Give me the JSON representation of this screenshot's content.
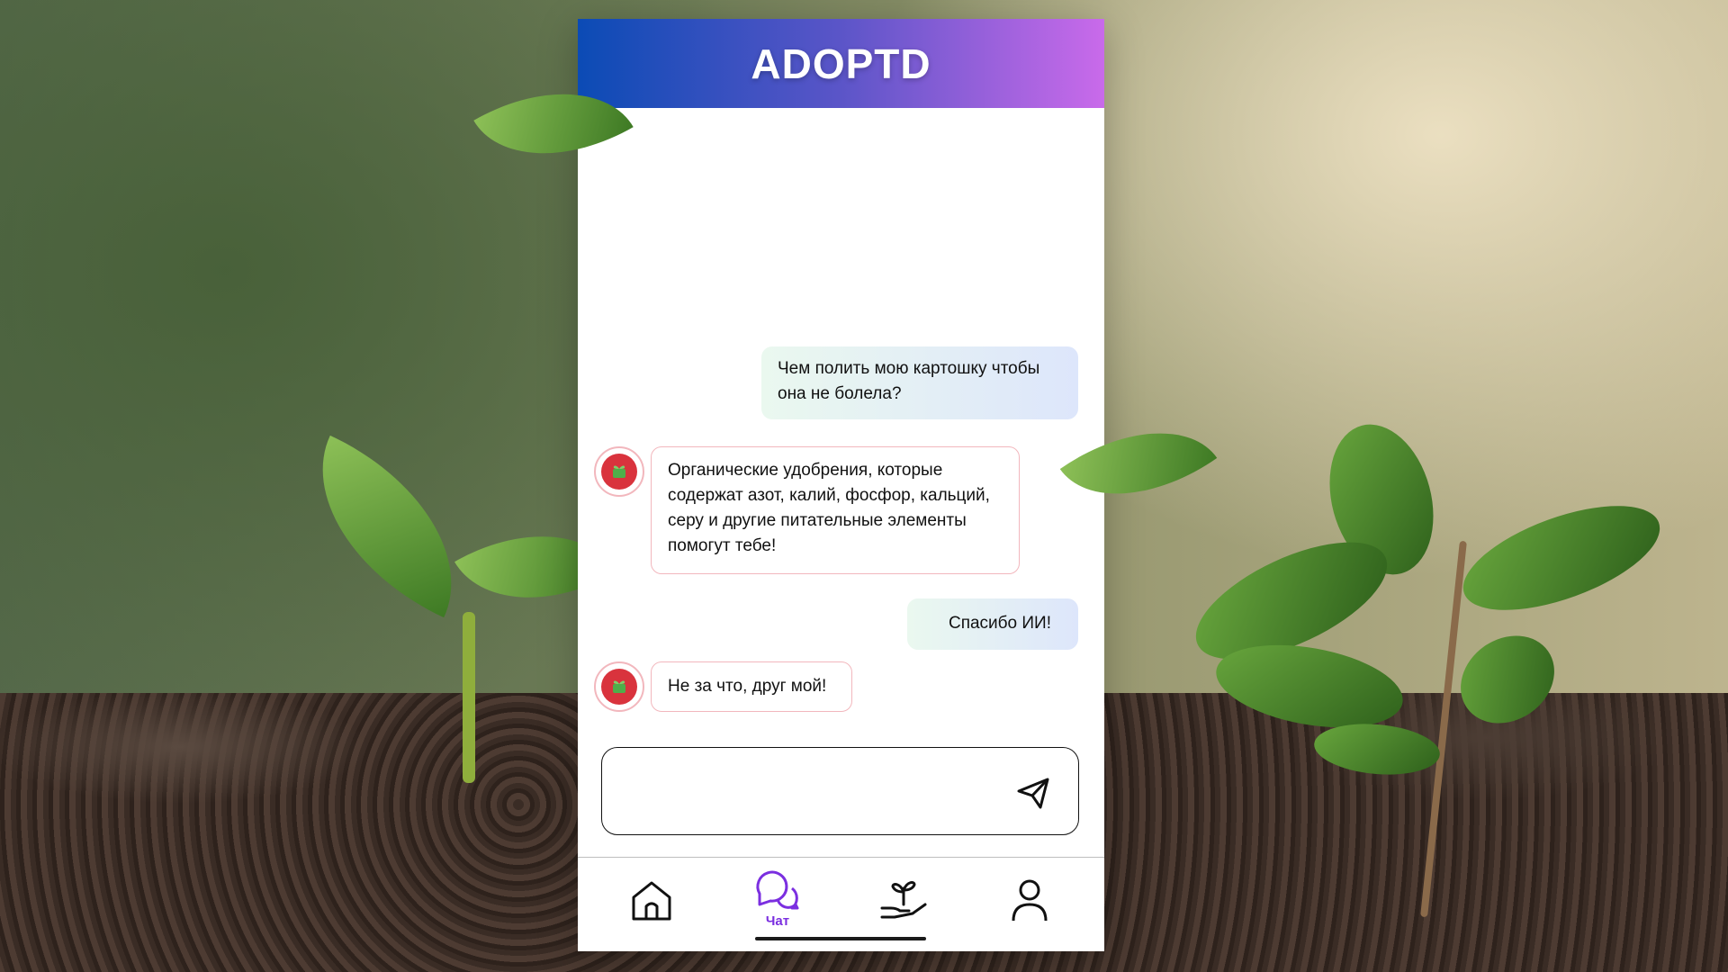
{
  "app": {
    "title": "ADOPTD"
  },
  "messages": [
    {
      "role": "user",
      "text": "Чем полить мою картошку чтобы она не болела?"
    },
    {
      "role": "ai",
      "text": "Органические удобрения, которые содержат азот, калий, фосфор, кальций, серу и другие питательные элементы помогут тебе!"
    },
    {
      "role": "user",
      "text": "Спасибо ИИ!"
    },
    {
      "role": "ai",
      "text": "Не за что, друг мой!"
    }
  ],
  "input": {
    "value": "",
    "placeholder": ""
  },
  "nav": {
    "items": [
      {
        "icon": "home-icon",
        "label": ""
      },
      {
        "icon": "chat-icon",
        "label": "Чат",
        "active": true
      },
      {
        "icon": "plant-hand-icon",
        "label": ""
      },
      {
        "icon": "profile-icon",
        "label": ""
      }
    ]
  },
  "colors": {
    "header_start": "#0b4bb5",
    "header_end": "#c96aea",
    "active_nav": "#7b2fe0",
    "ai_bubble_border": "#f2b7bd",
    "avatar": "#d9333d"
  }
}
